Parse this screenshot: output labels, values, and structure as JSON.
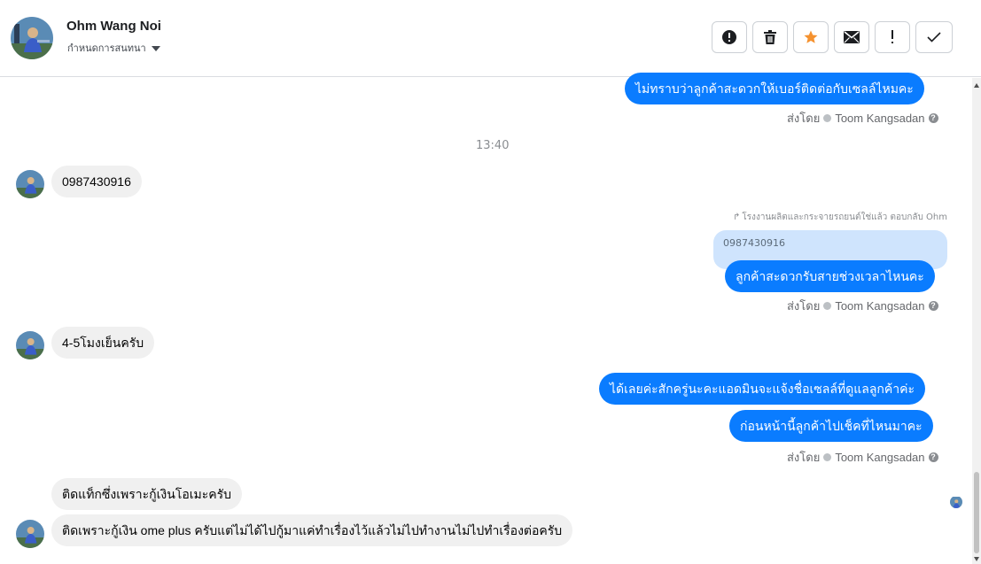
{
  "header": {
    "contact_name": "Ohm Wang Noi",
    "subtitle": "กำหนดการสนทนา",
    "actions": [
      {
        "name": "report-button",
        "icon": "exclamation-circle-icon"
      },
      {
        "name": "delete-button",
        "icon": "trash-icon"
      },
      {
        "name": "star-button",
        "icon": "star-icon"
      },
      {
        "name": "mark-unread-button",
        "icon": "envelope-icon"
      },
      {
        "name": "flag-button",
        "icon": "exclamation-icon"
      },
      {
        "name": "done-button",
        "icon": "check-icon"
      }
    ]
  },
  "colors": {
    "outgoing_bubble": "#0a7cff",
    "incoming_bubble": "#f0f0f0",
    "star": "#f5922f",
    "quote_bubble": "#cfe4fd"
  },
  "messages": {
    "m1": "ไม่ทราบว่าลูกค้าสะดวกให้เบอร์ติดต่อกับเซลล์ไหมคะ",
    "time": "13:40",
    "m2": "0987430916",
    "reply_label": "โรงงานผลิตและกระจายรถยนต์ใช่แล้ว ตอบกลับ Ohm",
    "quoted": "0987430916",
    "m3": "ลูกค้าสะดวกรับสายช่วงเวลาไหนคะ",
    "m4": "4-5โมงเย็นครับ",
    "m5": "ได้เลยค่ะสักครู่นะคะแอดมินจะแจ้งชื่อเซลล์ที่ดูแลลูกค้าค่ะ",
    "m6": "ก่อนหน้านี้ลูกค้าไปเช็คที่ไหนมาคะ",
    "m7": "ติดแท็กซึ่งเพราะกู้เงินโอเมะครับ",
    "m8": "ติดเพราะกู้เงิน ome plus ครับแต่ไม่ได้ไปกู้มาแค่ทำเรื่องไว้แล้วไม่ไปทำงานไม่ไปทำเรื่องต่อครับ"
  },
  "sent_by": {
    "prefix": "ส่งโดย",
    "agent": "Toom Kangsadan",
    "help": "?"
  }
}
